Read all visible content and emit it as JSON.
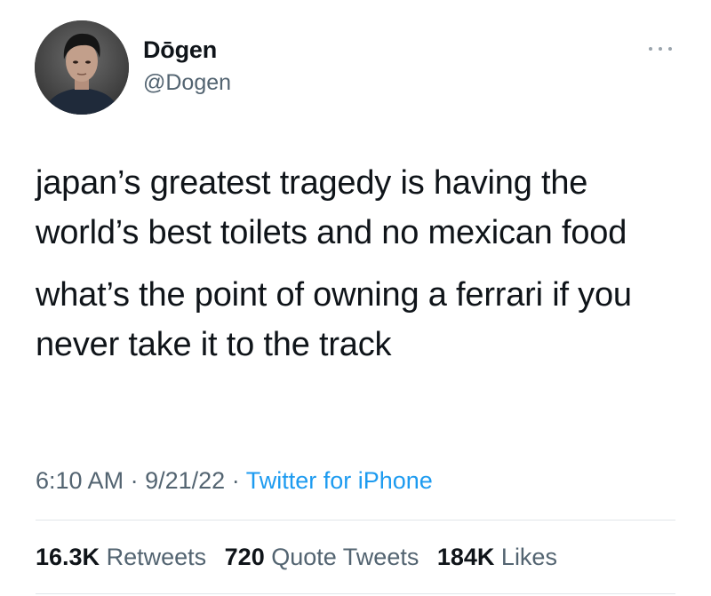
{
  "author": {
    "display_name": "Dōgen",
    "handle": "@Dogen"
  },
  "tweet": {
    "paragraphs": [
      "japan’s greatest tragedy is having the world’s best toilets and no mexican food",
      "what’s the point of owning a ferrari if you never take it to the track"
    ],
    "time": "6:10 AM",
    "date": "9/21/22",
    "separator": "·",
    "source": "Twitter for iPhone"
  },
  "stats": {
    "retweets_count": "16.3K",
    "retweets_label": "Retweets",
    "quotes_count": "720",
    "quotes_label": "Quote Tweets",
    "likes_count": "184K",
    "likes_label": "Likes"
  },
  "icons": {
    "more": "more-horizontal-icon"
  },
  "colors": {
    "text": "#0f1419",
    "secondary": "#536471",
    "link": "#1d9bf0"
  }
}
